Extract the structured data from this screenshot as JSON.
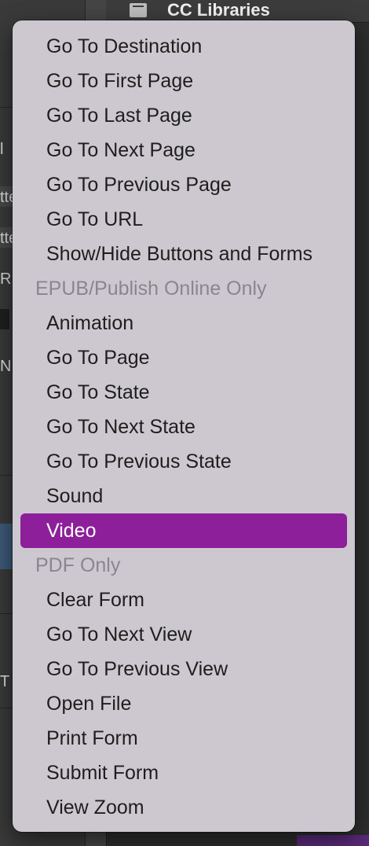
{
  "background": {
    "panel_title": "CC Libraries",
    "fragments": [
      "l",
      "tte",
      "tte",
      "R",
      "N",
      "T"
    ],
    "icons": [
      "libraries-icon"
    ]
  },
  "menu": {
    "sections": [
      {
        "header": null,
        "items": [
          {
            "label": "Go To Destination"
          },
          {
            "label": "Go To First Page"
          },
          {
            "label": "Go To Last Page"
          },
          {
            "label": "Go To Next Page"
          },
          {
            "label": "Go To Previous Page"
          },
          {
            "label": "Go To URL"
          },
          {
            "label": "Show/Hide Buttons and Forms"
          }
        ]
      },
      {
        "header": "EPUB/Publish Online Only",
        "items": [
          {
            "label": "Animation"
          },
          {
            "label": "Go To Page"
          },
          {
            "label": "Go To State"
          },
          {
            "label": "Go To Next State"
          },
          {
            "label": "Go To Previous State"
          },
          {
            "label": "Sound"
          },
          {
            "label": "Video",
            "selected": true
          }
        ]
      },
      {
        "header": "PDF Only",
        "items": [
          {
            "label": "Clear Form"
          },
          {
            "label": "Go To Next View"
          },
          {
            "label": "Go To Previous View"
          },
          {
            "label": "Open File"
          },
          {
            "label": "Print Form"
          },
          {
            "label": "Submit Form"
          },
          {
            "label": "View Zoom"
          }
        ]
      }
    ],
    "colors": {
      "background": "#cdc8cf",
      "text": "#1e1e1e",
      "header_text": "#8a8590",
      "highlight": "#8e1f9a",
      "highlight_text": "#ffffff"
    }
  }
}
